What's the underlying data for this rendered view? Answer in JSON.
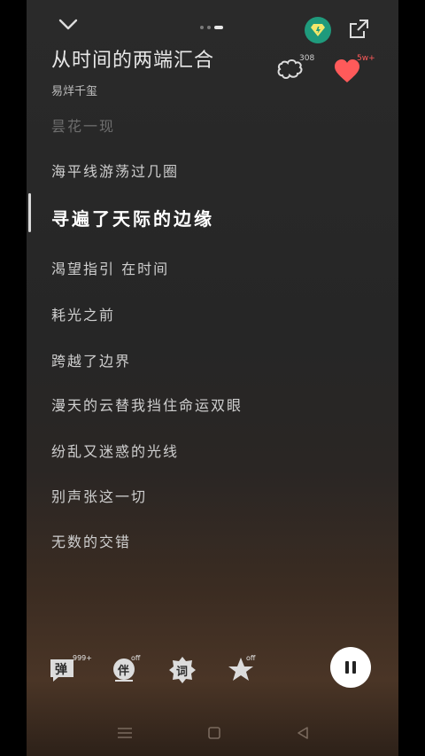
{
  "header": {
    "collapse_icon": "chevron-down-icon",
    "vip_icon": "diamond-icon",
    "share_icon": "share-icon",
    "pager_pages": 3,
    "pager_active": 3
  },
  "song": {
    "title": "从时间的两端汇合",
    "artist": "易烊千玺"
  },
  "actions": {
    "pillow_count": "308",
    "like_count": "5w+"
  },
  "lyrics": {
    "lines": [
      {
        "text": "昙花一现",
        "state": "faded"
      },
      {
        "text": "海平线游荡过几圈",
        "state": "normal"
      },
      {
        "text": "寻遍了天际的边缘",
        "state": "current"
      },
      {
        "text": "渴望指引 在时间",
        "state": "normal"
      },
      {
        "text": "耗光之前",
        "state": "normal"
      },
      {
        "text": "跨越了边界",
        "state": "normal"
      },
      {
        "text": "漫天的云替我挡住命运双眼",
        "state": "normal"
      },
      {
        "text": "纷乱又迷惑的光线",
        "state": "normal"
      },
      {
        "text": "别声张这一切",
        "state": "normal"
      },
      {
        "text": "无数的交错",
        "state": "normal"
      }
    ]
  },
  "bottom": {
    "danmu_label": "弹",
    "danmu_badge": "999+",
    "accompany_label": "伴",
    "accompany_badge": "off",
    "lyric_label": "词",
    "effect_badge": "off"
  },
  "colors": {
    "accent_green": "#1f9a7c",
    "heart_red": "#ff5a5a"
  }
}
